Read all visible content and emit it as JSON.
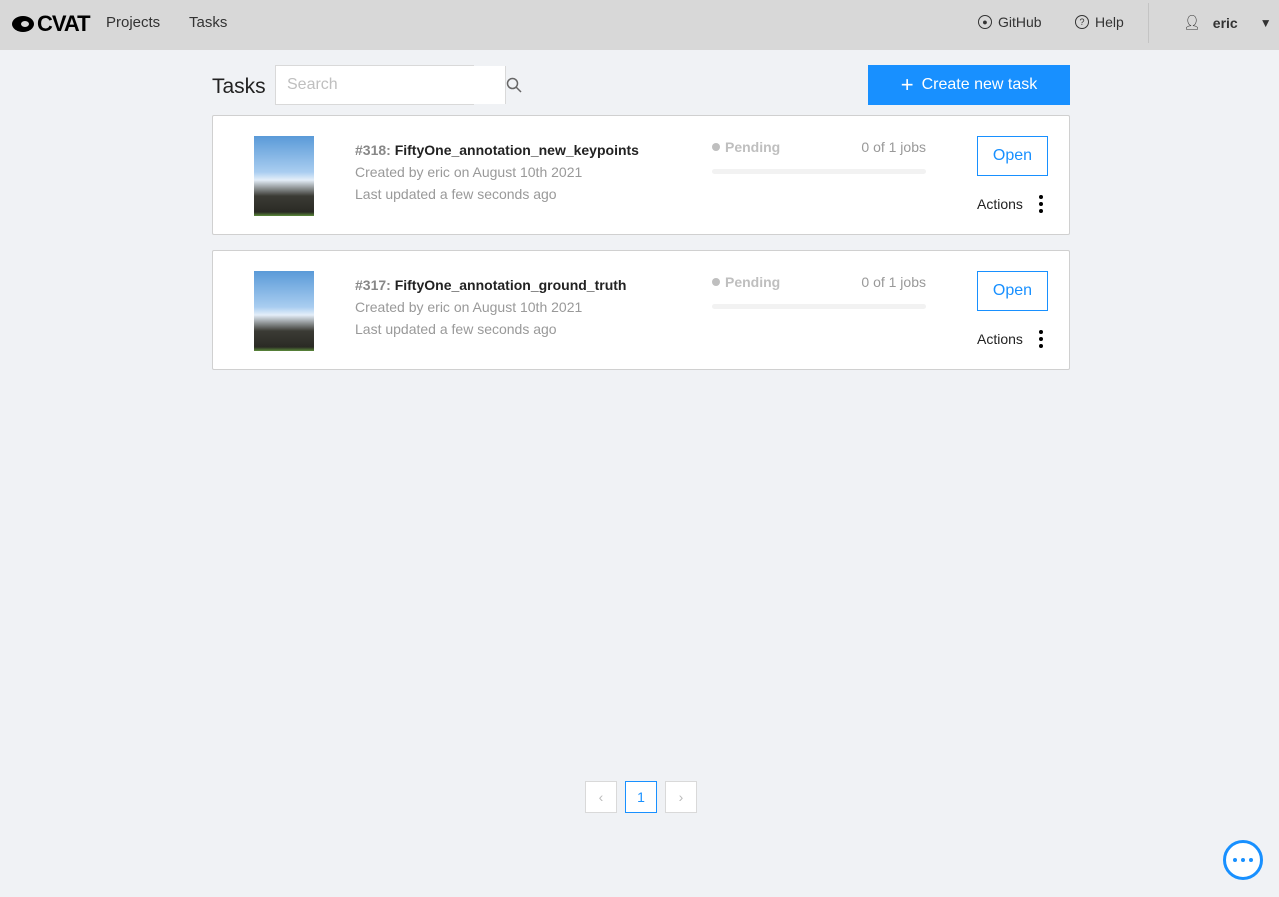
{
  "header": {
    "logo": "CVAT",
    "nav": [
      "Projects",
      "Tasks"
    ],
    "github": "GitHub",
    "help": "Help",
    "user": "eric"
  },
  "toolbar": {
    "title": "Tasks",
    "search_placeholder": "Search",
    "search_value": "",
    "create_label": "Create new task"
  },
  "tasks": [
    {
      "id": "#318:",
      "name": "FiftyOne_annotation_new_keypoints",
      "created": "Created by eric on August 10th 2021",
      "updated": "Last updated a few seconds ago",
      "status": "Pending",
      "jobs": "0 of 1 jobs",
      "progress": 0,
      "open": "Open",
      "actions": "Actions"
    },
    {
      "id": "#317:",
      "name": "FiftyOne_annotation_ground_truth",
      "created": "Created by eric on August 10th 2021",
      "updated": "Last updated a few seconds ago",
      "status": "Pending",
      "jobs": "0 of 1 jobs",
      "progress": 0,
      "open": "Open",
      "actions": "Actions"
    }
  ],
  "pagination": {
    "prev": "‹",
    "current": "1",
    "next": "›"
  },
  "colors": {
    "accent": "#1890ff",
    "header_bg": "#d8d8d8",
    "page_bg": "#f0f2f5"
  }
}
